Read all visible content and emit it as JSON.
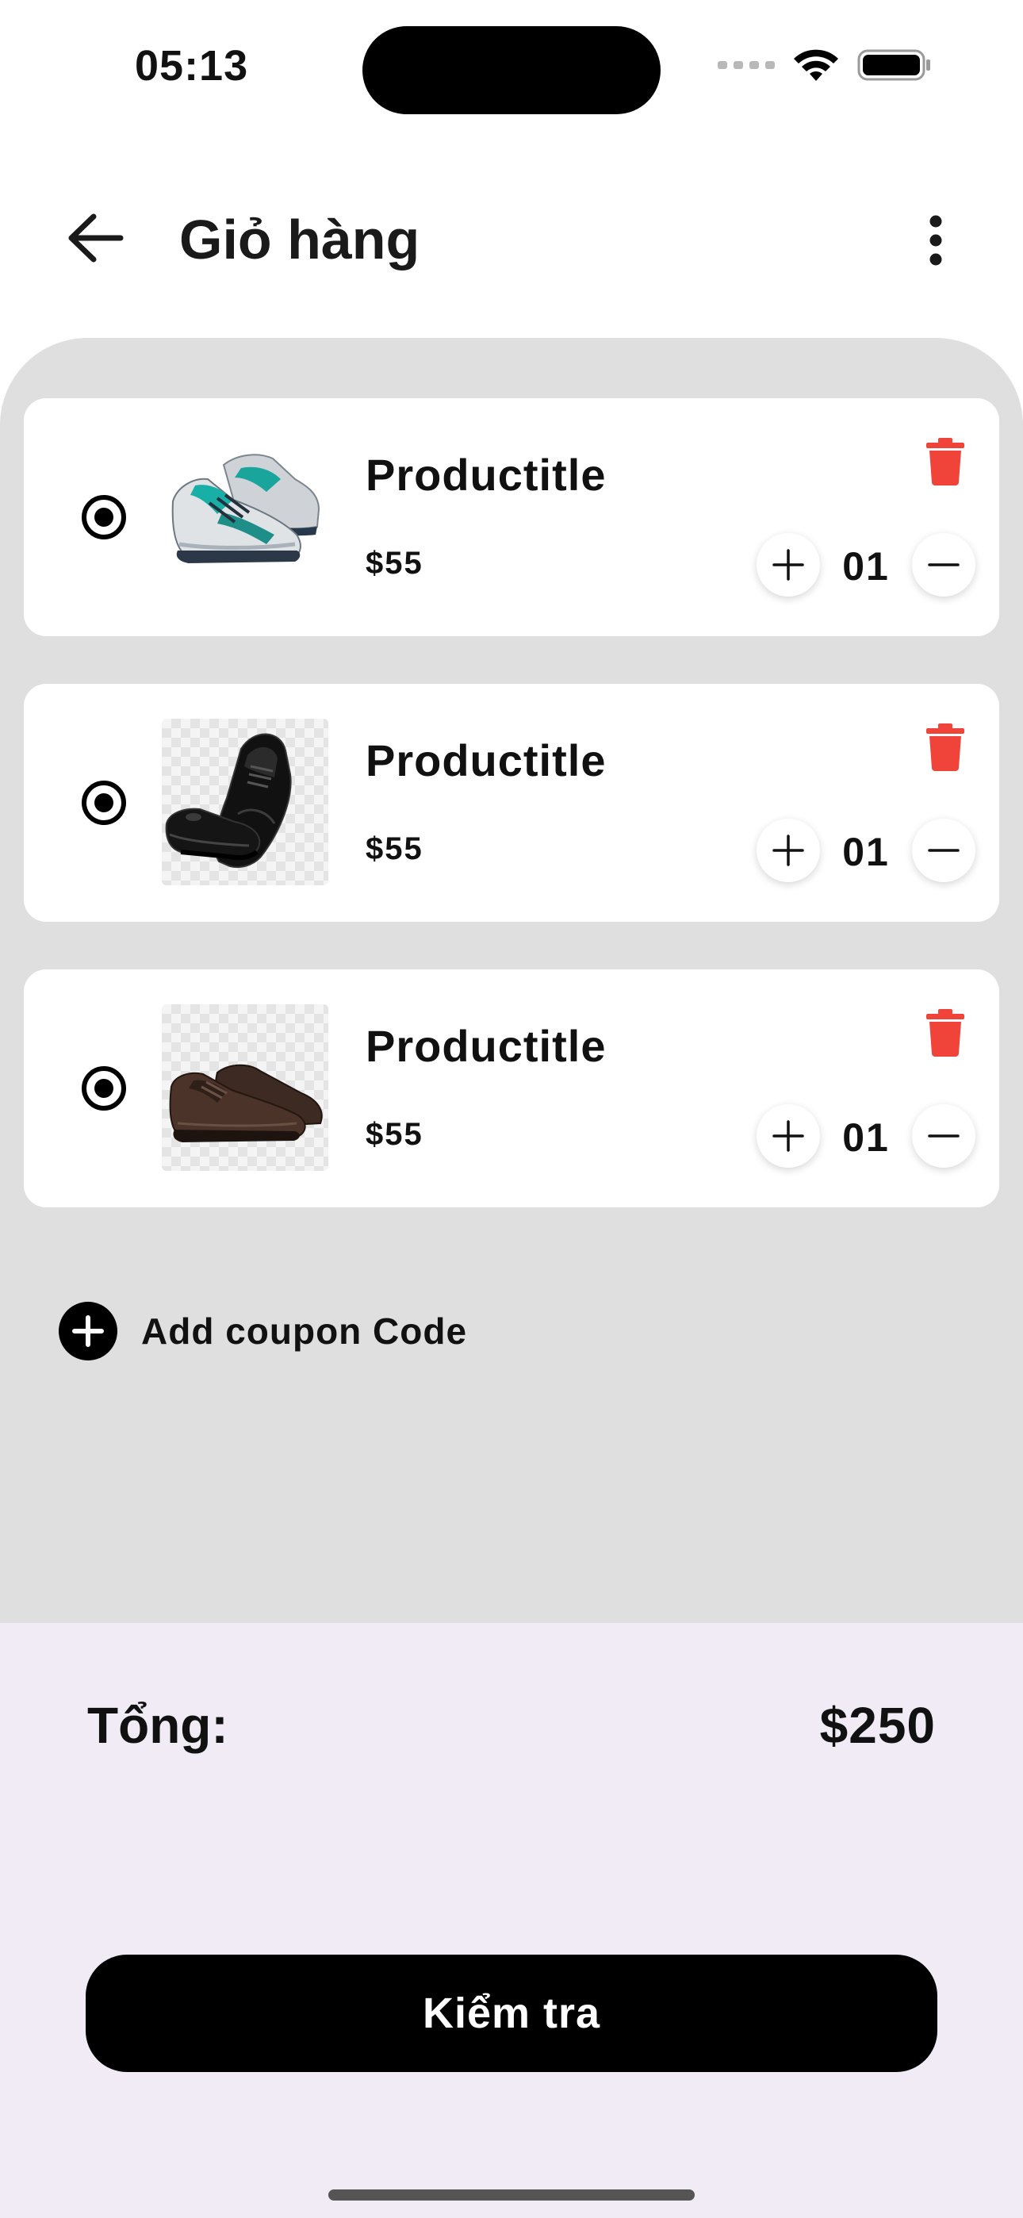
{
  "status_bar": {
    "time": "05:13"
  },
  "header": {
    "title": "Giỏ hàng",
    "back_icon": "arrow-left-icon",
    "menu_icon": "more-vertical-icon"
  },
  "cart": {
    "items": [
      {
        "title": "Productitle",
        "price": "$55",
        "quantity": "01",
        "selected": true,
        "image": "running-sneaker"
      },
      {
        "title": "Productitle",
        "price": "$55",
        "quantity": "01",
        "selected": true,
        "image": "black-dress-shoe"
      },
      {
        "title": "Productitle",
        "price": "$55",
        "quantity": "01",
        "selected": true,
        "image": "brown-derby-shoe"
      }
    ]
  },
  "coupon": {
    "label": "Add coupon Code"
  },
  "summary": {
    "total_label": "Tổng:",
    "total_value": "$250",
    "checkout_label": "Kiểm tra"
  },
  "colors": {
    "cart_background": "#dfdfdf",
    "summary_background": "#f1ebf6",
    "trash": "#f0443a",
    "primary": "#000000"
  }
}
